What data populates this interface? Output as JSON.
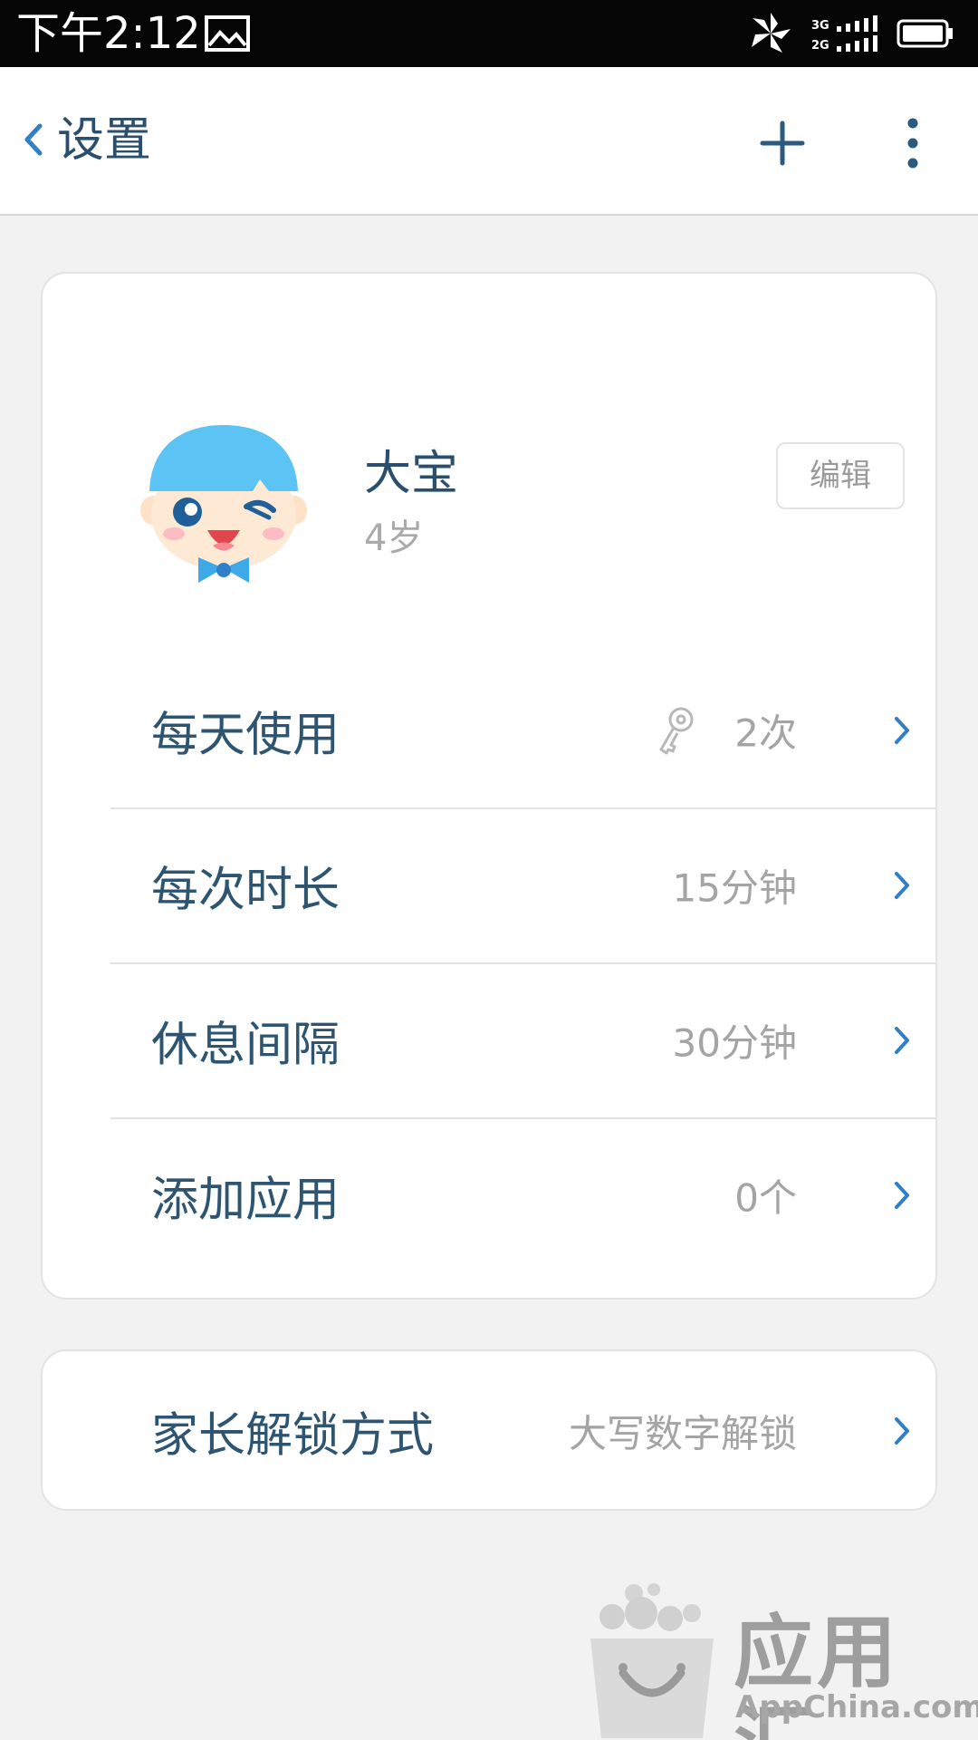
{
  "status_bar": {
    "time": "下午2:12",
    "network_top": "3G",
    "network_bottom": "2G",
    "icons": [
      "gallery-icon",
      "pinwheel-icon",
      "signal-icon",
      "battery-icon"
    ]
  },
  "header": {
    "title": "设置",
    "icons": [
      "back-chevron-icon",
      "plus-icon",
      "more-vertical-icon"
    ]
  },
  "profile": {
    "name": "大宝",
    "age": "4岁",
    "edit_label": "编辑"
  },
  "settings": [
    {
      "label": "每天使用",
      "value": "2次",
      "icon": "key-icon"
    },
    {
      "label": "每次时长",
      "value": "15分钟"
    },
    {
      "label": "休息间隔",
      "value": "30分钟"
    },
    {
      "label": "添加应用",
      "value": "0个"
    }
  ],
  "unlock": {
    "label": "家长解锁方式",
    "value": "大写数字解锁"
  },
  "watermark": {
    "title": "应用汇",
    "subtitle": "AppChina.com"
  },
  "colors": {
    "status_bar": "#050505",
    "header_bg": "#ffffff",
    "page_bg": "#f2f2f2",
    "label_text": "#2d5572",
    "value_text": "#a4a4a4",
    "accent_blue": "#2f80c8",
    "avatar_hair": "#5cc3f5"
  }
}
